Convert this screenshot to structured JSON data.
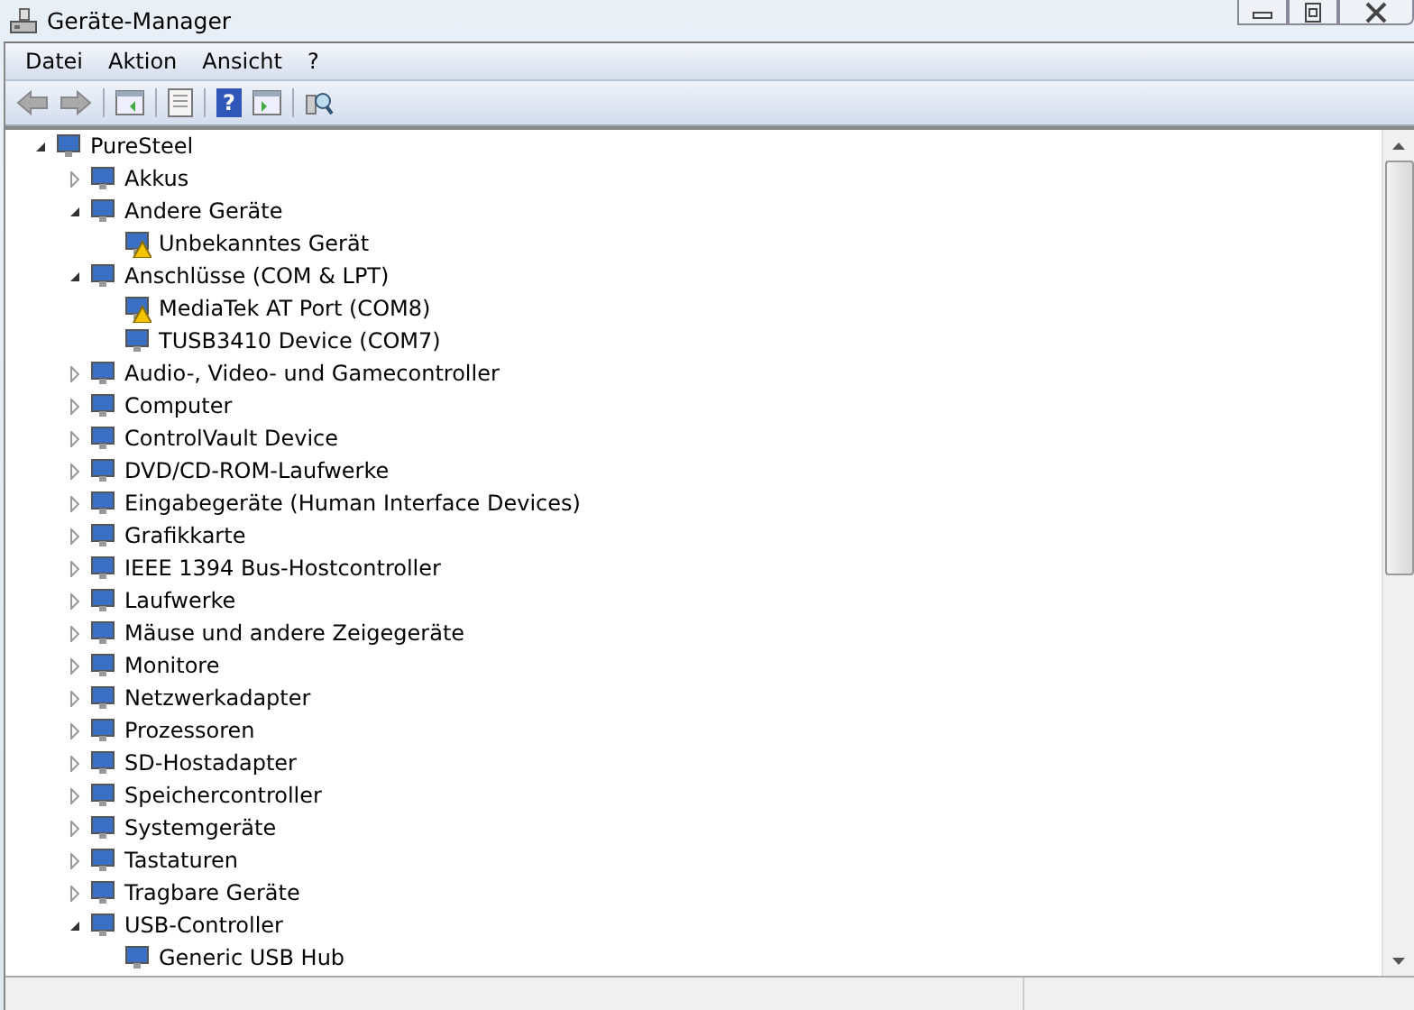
{
  "window": {
    "title": "Geräte-Manager"
  },
  "menu": [
    "Datei",
    "Aktion",
    "Ansicht",
    "?"
  ],
  "toolbar": {
    "help_glyph": "?"
  },
  "tree": [
    {
      "label": "PureSteel",
      "expanded": true,
      "warning": false,
      "children": [
        {
          "label": "Akkus",
          "expanded": false,
          "warning": false
        },
        {
          "label": "Andere Geräte",
          "expanded": true,
          "warning": false,
          "children": [
            {
              "label": "Unbekanntes Gerät",
              "warning": true
            }
          ]
        },
        {
          "label": "Anschlüsse (COM & LPT)",
          "expanded": true,
          "warning": false,
          "children": [
            {
              "label": "MediaTek AT Port (COM8)",
              "warning": true
            },
            {
              "label": "TUSB3410 Device (COM7)",
              "warning": false
            }
          ]
        },
        {
          "label": "Audio-, Video- und Gamecontroller",
          "expanded": false,
          "warning": false
        },
        {
          "label": "Computer",
          "expanded": false,
          "warning": false
        },
        {
          "label": "ControlVault Device",
          "expanded": false,
          "warning": false
        },
        {
          "label": "DVD/CD-ROM-Laufwerke",
          "expanded": false,
          "warning": false
        },
        {
          "label": "Eingabegeräte (Human Interface Devices)",
          "expanded": false,
          "warning": false
        },
        {
          "label": "Grafikkarte",
          "expanded": false,
          "warning": false
        },
        {
          "label": "IEEE 1394 Bus-Hostcontroller",
          "expanded": false,
          "warning": false
        },
        {
          "label": "Laufwerke",
          "expanded": false,
          "warning": false
        },
        {
          "label": "Mäuse und andere Zeigegeräte",
          "expanded": false,
          "warning": false
        },
        {
          "label": "Monitore",
          "expanded": false,
          "warning": false
        },
        {
          "label": "Netzwerkadapter",
          "expanded": false,
          "warning": false
        },
        {
          "label": "Prozessoren",
          "expanded": false,
          "warning": false
        },
        {
          "label": "SD-Hostadapter",
          "expanded": false,
          "warning": false
        },
        {
          "label": "Speichercontroller",
          "expanded": false,
          "warning": false
        },
        {
          "label": "Systemgeräte",
          "expanded": false,
          "warning": false
        },
        {
          "label": "Tastaturen",
          "expanded": false,
          "warning": false
        },
        {
          "label": "Tragbare Geräte",
          "expanded": false,
          "warning": false
        },
        {
          "label": "USB-Controller",
          "expanded": true,
          "warning": false,
          "children": [
            {
              "label": "Generic USB Hub",
              "warning": false
            }
          ]
        }
      ]
    }
  ]
}
